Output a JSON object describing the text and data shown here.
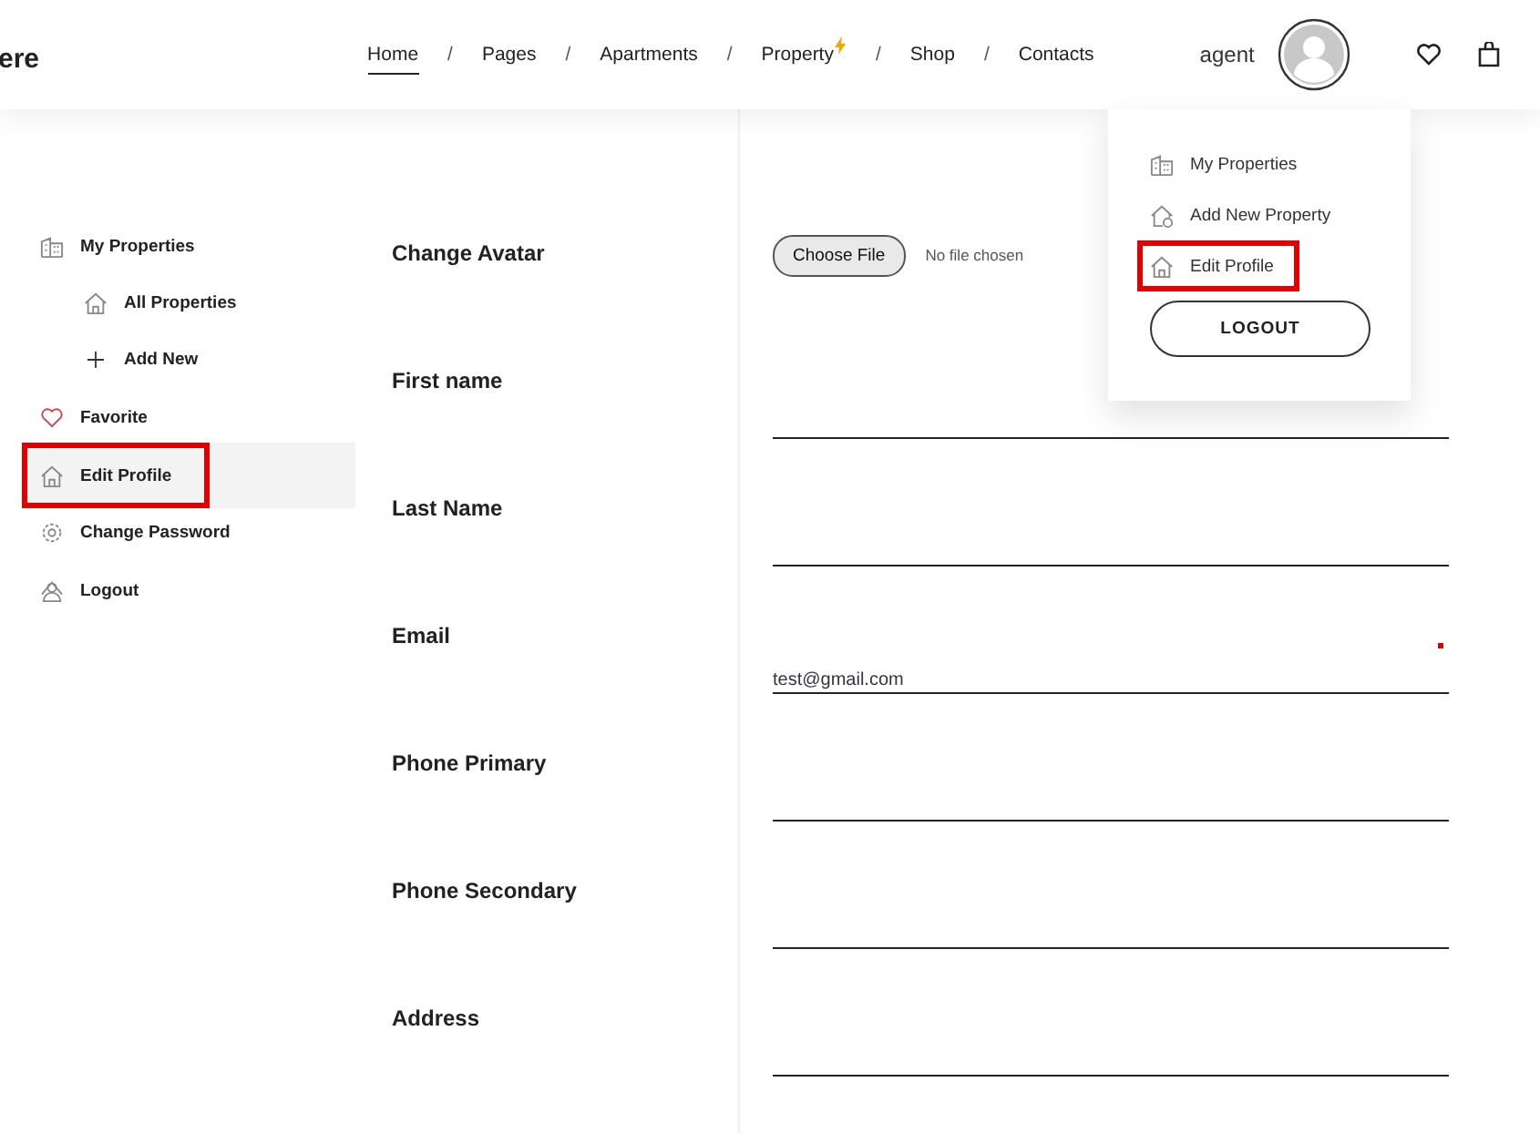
{
  "header": {
    "logo": "ere",
    "nav": [
      {
        "label": "Home",
        "selected": true,
        "badge": false
      },
      {
        "label": "Pages",
        "selected": false,
        "badge": false
      },
      {
        "label": "Apartments",
        "selected": false,
        "badge": false
      },
      {
        "label": "Property",
        "selected": false,
        "badge": true
      },
      {
        "label": "Shop",
        "selected": false,
        "badge": false
      },
      {
        "label": "Contacts",
        "selected": false,
        "badge": false
      }
    ],
    "separator": "/",
    "user": "agent"
  },
  "sidebar": {
    "items": [
      {
        "label": "My Properties",
        "selected": false,
        "highlighted": false,
        "children": [
          {
            "label": "All Properties"
          },
          {
            "label": "Add New"
          }
        ]
      },
      {
        "label": "Favorite",
        "selected": false,
        "highlighted": false
      },
      {
        "label": "Edit Profile",
        "selected": true,
        "highlighted": true
      },
      {
        "label": "Change Password",
        "selected": false,
        "highlighted": false
      },
      {
        "label": "Logout",
        "selected": false,
        "highlighted": false
      }
    ]
  },
  "form": {
    "fields": [
      {
        "kind": "file",
        "label": "Change Avatar",
        "button": "Choose File",
        "status": "No file chosen"
      },
      {
        "kind": "text",
        "label": "First name",
        "required": false
      },
      {
        "kind": "text",
        "label": "Last Name",
        "required": false
      },
      {
        "kind": "text",
        "label": "Email",
        "value": "test@gmail.com",
        "required": true
      },
      {
        "kind": "text",
        "label": "Phone Primary",
        "required": false
      },
      {
        "kind": "text",
        "label": "Phone Secondary",
        "required": false
      },
      {
        "kind": "text",
        "label": "Address",
        "required": false
      }
    ]
  },
  "dropdown": {
    "items": [
      {
        "label": "My Properties",
        "highlighted": false
      },
      {
        "label": "Add New Property",
        "highlighted": false
      },
      {
        "label": "Edit Profile",
        "highlighted": true
      }
    ],
    "button": "LOGOUT"
  }
}
